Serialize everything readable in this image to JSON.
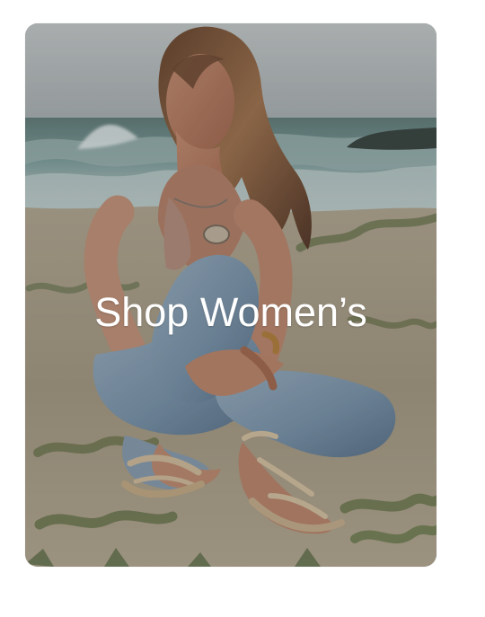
{
  "card": {
    "title": "Shop Women’s",
    "image_subject": "woman-sitting-on-beach-wearing-sandals"
  },
  "colors": {
    "page_background": "#ffffff",
    "text": "#ffffff"
  }
}
